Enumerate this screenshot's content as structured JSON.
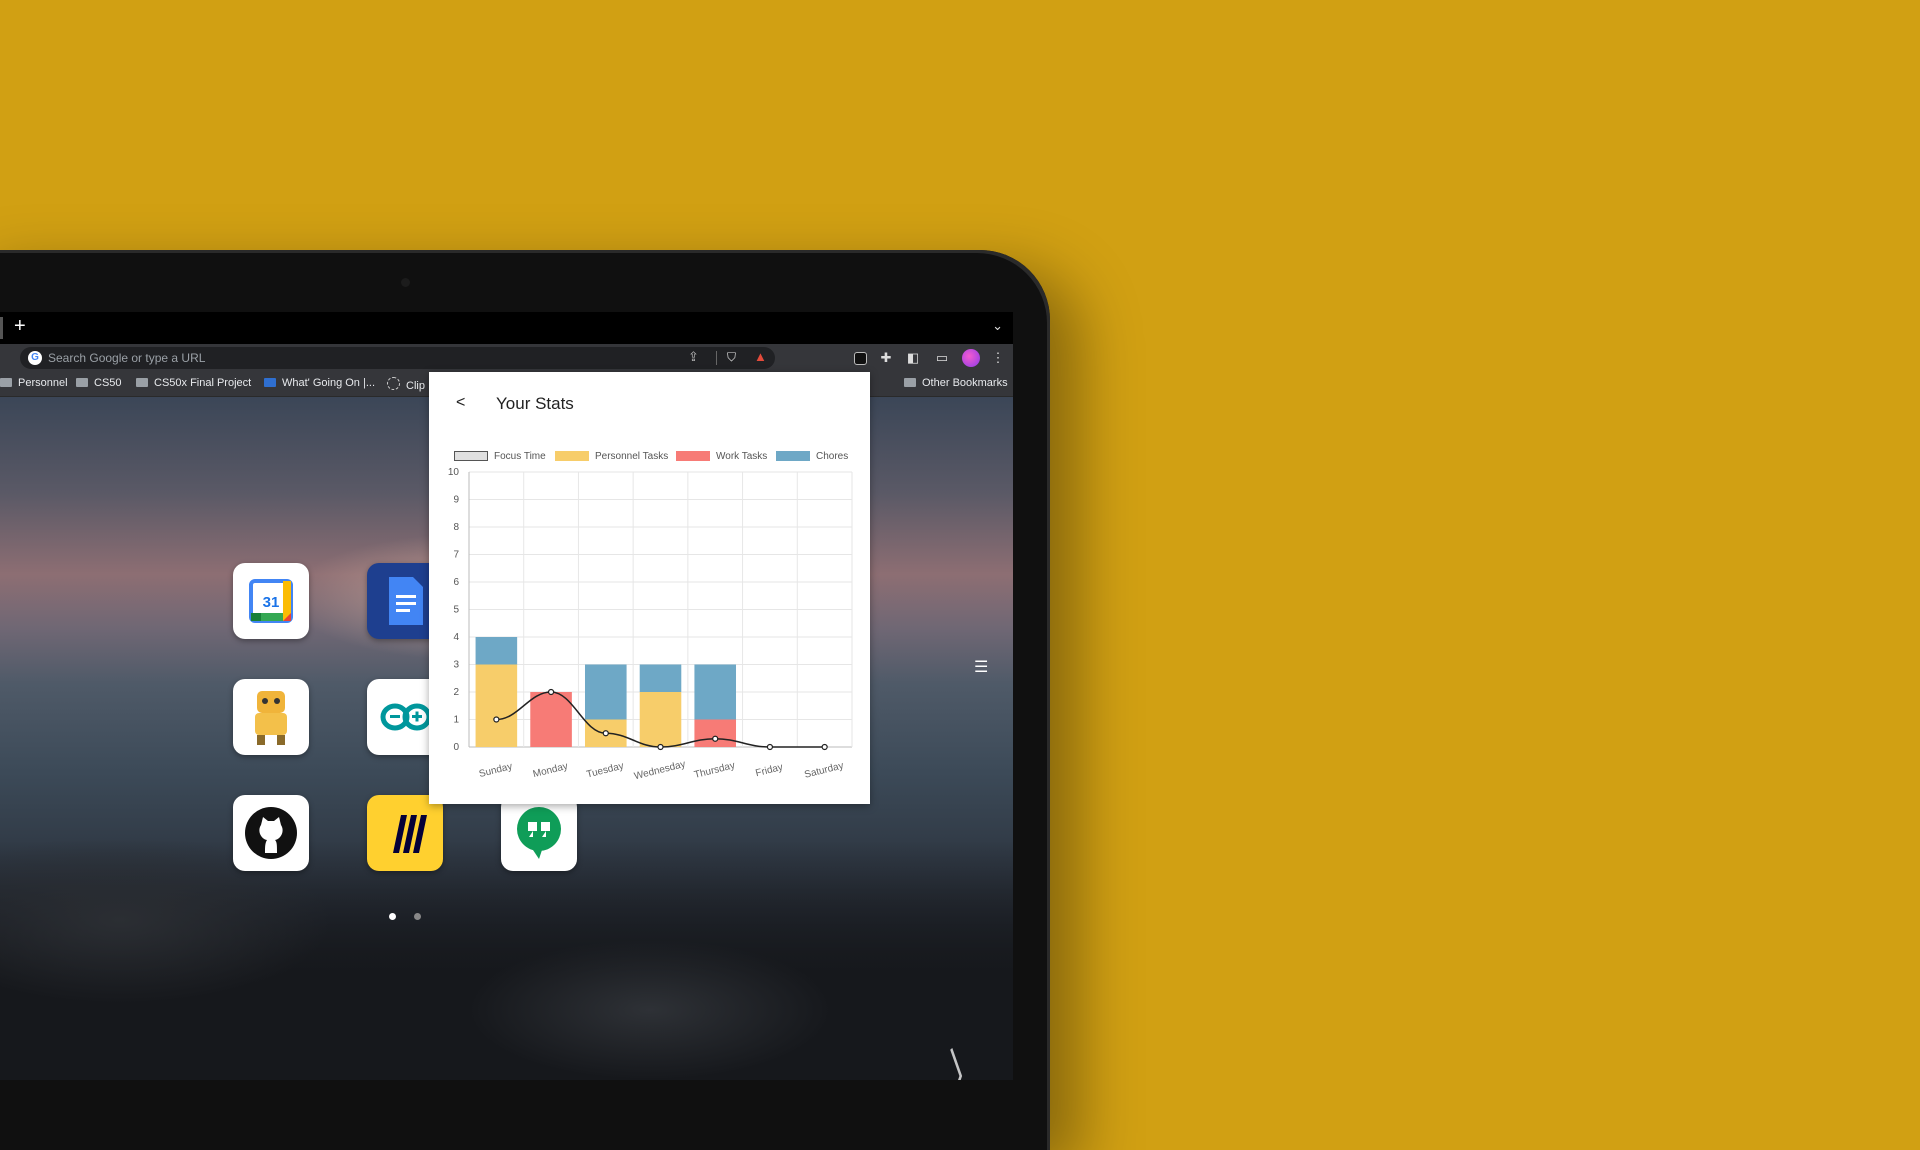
{
  "browser": {
    "new_tab_symbol": "+",
    "tab_menu_symbol": "⌄",
    "omnibox": {
      "placeholder": "Search Google or type a URL",
      "google_glyph": "G"
    },
    "toolbar_icons": [
      "share-icon",
      "brave-shield-icon",
      "brave-rewards-icon",
      "extension-icon",
      "puzzle-icon",
      "sidebar-icon",
      "wallet-icon",
      "avatar-icon",
      "menu-icon"
    ],
    "bookmarks": [
      {
        "label": "Personnel",
        "icon": "folder-icon"
      },
      {
        "label": "CS50",
        "icon": "folder-icon"
      },
      {
        "label": "CS50x Final Project",
        "icon": "folder-icon"
      },
      {
        "label": "What' Going On |...",
        "icon": "trello-icon"
      },
      {
        "label": "Clip",
        "icon": "clip-icon"
      }
    ],
    "other_bookmarks": "Other Bookmarks"
  },
  "new_tab_page": {
    "apps": [
      "google-calendar",
      "google-docs",
      "robot-app",
      "arduino",
      "github",
      "miro",
      "hangouts"
    ],
    "calendar_day": "31",
    "page_dots": 2,
    "active_page": 0
  },
  "popup": {
    "back_label": "<",
    "title": "Your Stats"
  },
  "colors": {
    "background": "#d1a013",
    "focus": "#e0e0e0",
    "personnel": "#f7cd6a",
    "work": "#f77b76",
    "chores": "#6ea8c6"
  },
  "chart_data": {
    "type": "bar",
    "stacked": true,
    "categories": [
      "Sunday",
      "Monday",
      "Tuesday",
      "Wednesday",
      "Thursday",
      "Friday",
      "Saturday"
    ],
    "series": [
      {
        "name": "Personnel Tasks",
        "values": [
          3,
          0,
          1,
          2,
          0,
          0,
          0
        ]
      },
      {
        "name": "Work Tasks",
        "values": [
          0,
          2,
          0,
          0,
          1,
          0,
          0
        ]
      },
      {
        "name": "Chores",
        "values": [
          1,
          0,
          2,
          1,
          2,
          0,
          0
        ]
      }
    ],
    "line_series": {
      "name": "Focus Time",
      "values": [
        1,
        2,
        0.5,
        0,
        0.3,
        0,
        0
      ]
    },
    "ylim": [
      0,
      10
    ],
    "y_ticks": [
      "0",
      "1",
      "2",
      "3",
      "4",
      "5",
      "6",
      "7",
      "8",
      "9",
      "10"
    ],
    "legend_position": "top",
    "grid": true
  }
}
